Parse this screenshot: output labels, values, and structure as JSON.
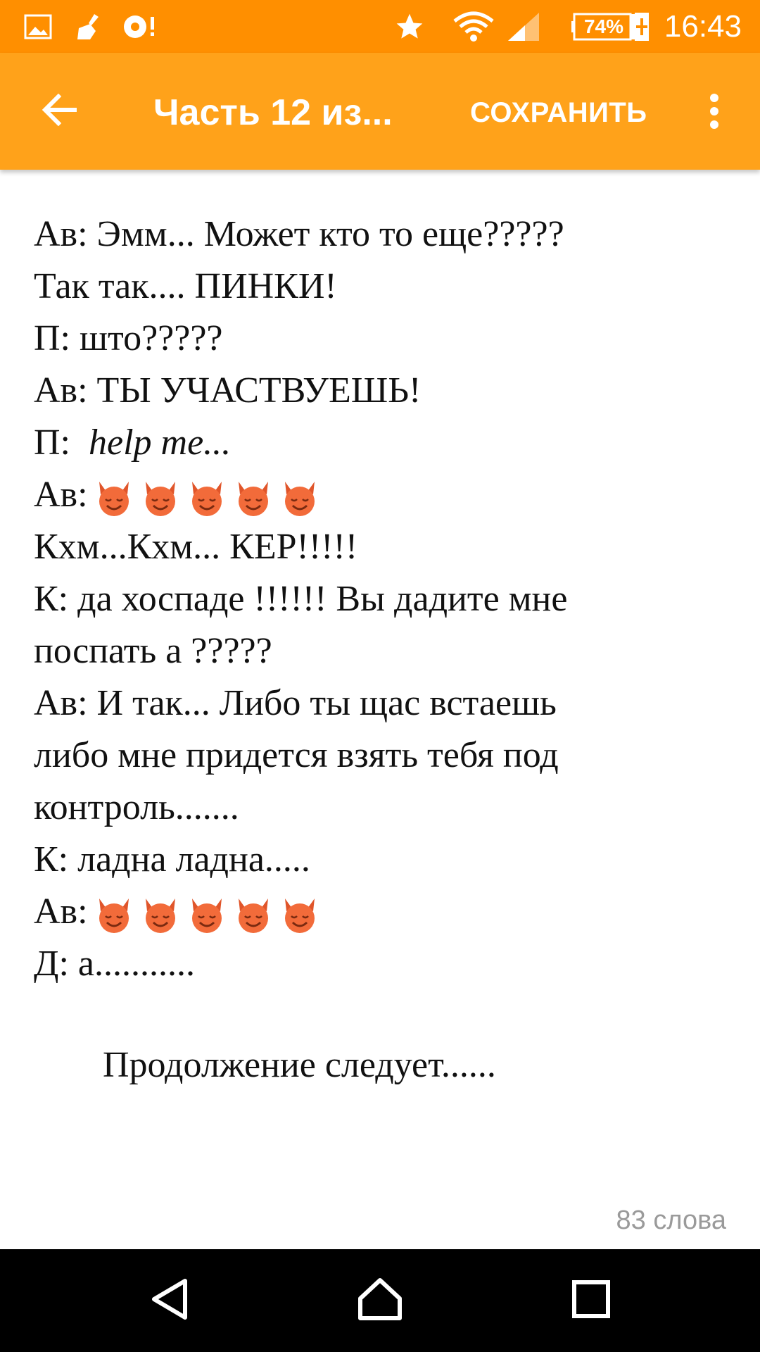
{
  "status_bar": {
    "time": "16:43",
    "battery_percent": "74%",
    "icons": [
      "image-icon",
      "cleaner-icon",
      "notification-icon",
      "star-icon",
      "wifi-icon",
      "signal-icon",
      "battery-charging-icon"
    ]
  },
  "app_bar": {
    "title": "Часть 12 из...",
    "save_label": "СОХРАНИТЬ",
    "back_icon": "back-arrow-icon",
    "more_icon": "more-vert-icon"
  },
  "story": {
    "lines": [
      "Ав: Эмм... Может кто то еще?????",
      "Так так.... ПИНКИ!",
      "П: што?????",
      "Ав: ТЫ УЧАСТВУЕШЬ!",
      "П:",
      "help me...",
      "Ав:",
      "Кхм...Кхм... КЕР!!!!!",
      "К: да хоспаде !!!!!! Вы дадите мне",
      "поспать а ?????",
      "Ав: И так... Либо ты щас встаешь",
      "либо мне придется взять тебя под",
      "контроль.......",
      "К: ладна ладна.....",
      "Ав:",
      "Д: а..........."
    ],
    "emoji_name": "smiling-devil-emoji",
    "continued": "Продолжение следует......"
  },
  "footer": {
    "word_count": "83 слова"
  },
  "nav_bar": {
    "icons": [
      "nav-back-icon",
      "nav-home-icon",
      "nav-recents-icon"
    ]
  },
  "colors": {
    "status_bar": "#ff8f00",
    "app_bar": "#ffa21a",
    "emoji": "#f26b3a"
  }
}
